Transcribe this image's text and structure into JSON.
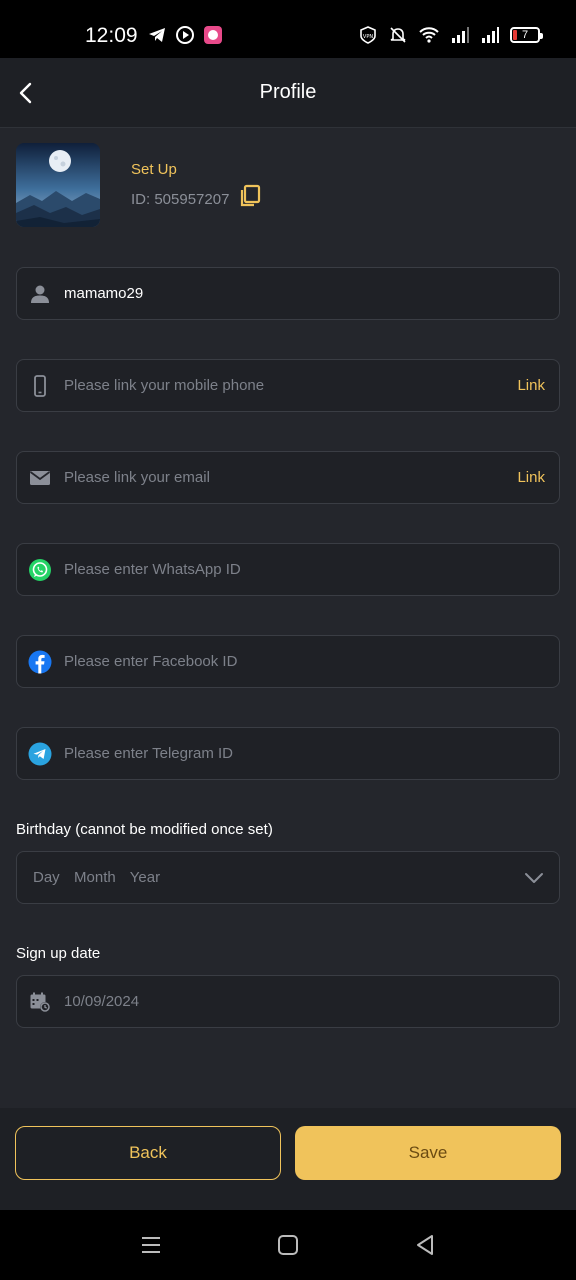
{
  "status_bar": {
    "time": "12:09",
    "battery_level": "7",
    "icons": [
      "telegram-icon",
      "play-icon",
      "app-icon",
      "vpn-icon",
      "mute-icon",
      "wifi-icon",
      "signal-icon",
      "signal-icon-2",
      "battery-icon"
    ]
  },
  "header": {
    "title": "Profile",
    "back_icon": "chevron-left-icon"
  },
  "profile": {
    "setup_label": "Set Up",
    "id_label": "ID: 505957207"
  },
  "fields": {
    "username": {
      "value": "mamamo29",
      "icon": "user-icon"
    },
    "phone": {
      "placeholder": "Please link your mobile phone",
      "action": "Link",
      "icon": "phone-icon"
    },
    "email": {
      "placeholder": "Please link your email",
      "action": "Link",
      "icon": "mail-icon"
    },
    "whatsapp": {
      "placeholder": "Please enter WhatsApp ID",
      "icon": "whatsapp-icon"
    },
    "facebook": {
      "placeholder": "Please enter Facebook ID",
      "icon": "facebook-icon"
    },
    "telegram": {
      "placeholder": "Please enter Telegram ID",
      "icon": "telegram-icon"
    }
  },
  "birthday": {
    "label": "Birthday (cannot be modified once set)",
    "placeholder": "Day  Month  Year"
  },
  "signup": {
    "label": "Sign up date",
    "value": "10/09/2024"
  },
  "actions": {
    "back_label": "Back",
    "save_label": "Save"
  },
  "colors": {
    "accent": "#f0c35b",
    "background": "#24262c",
    "field_bg": "#1f2126",
    "field_border": "#3a3d44",
    "placeholder": "#7d818a",
    "whatsapp": "#25d366",
    "facebook": "#1877f2",
    "telegram": "#2aa3e0"
  }
}
